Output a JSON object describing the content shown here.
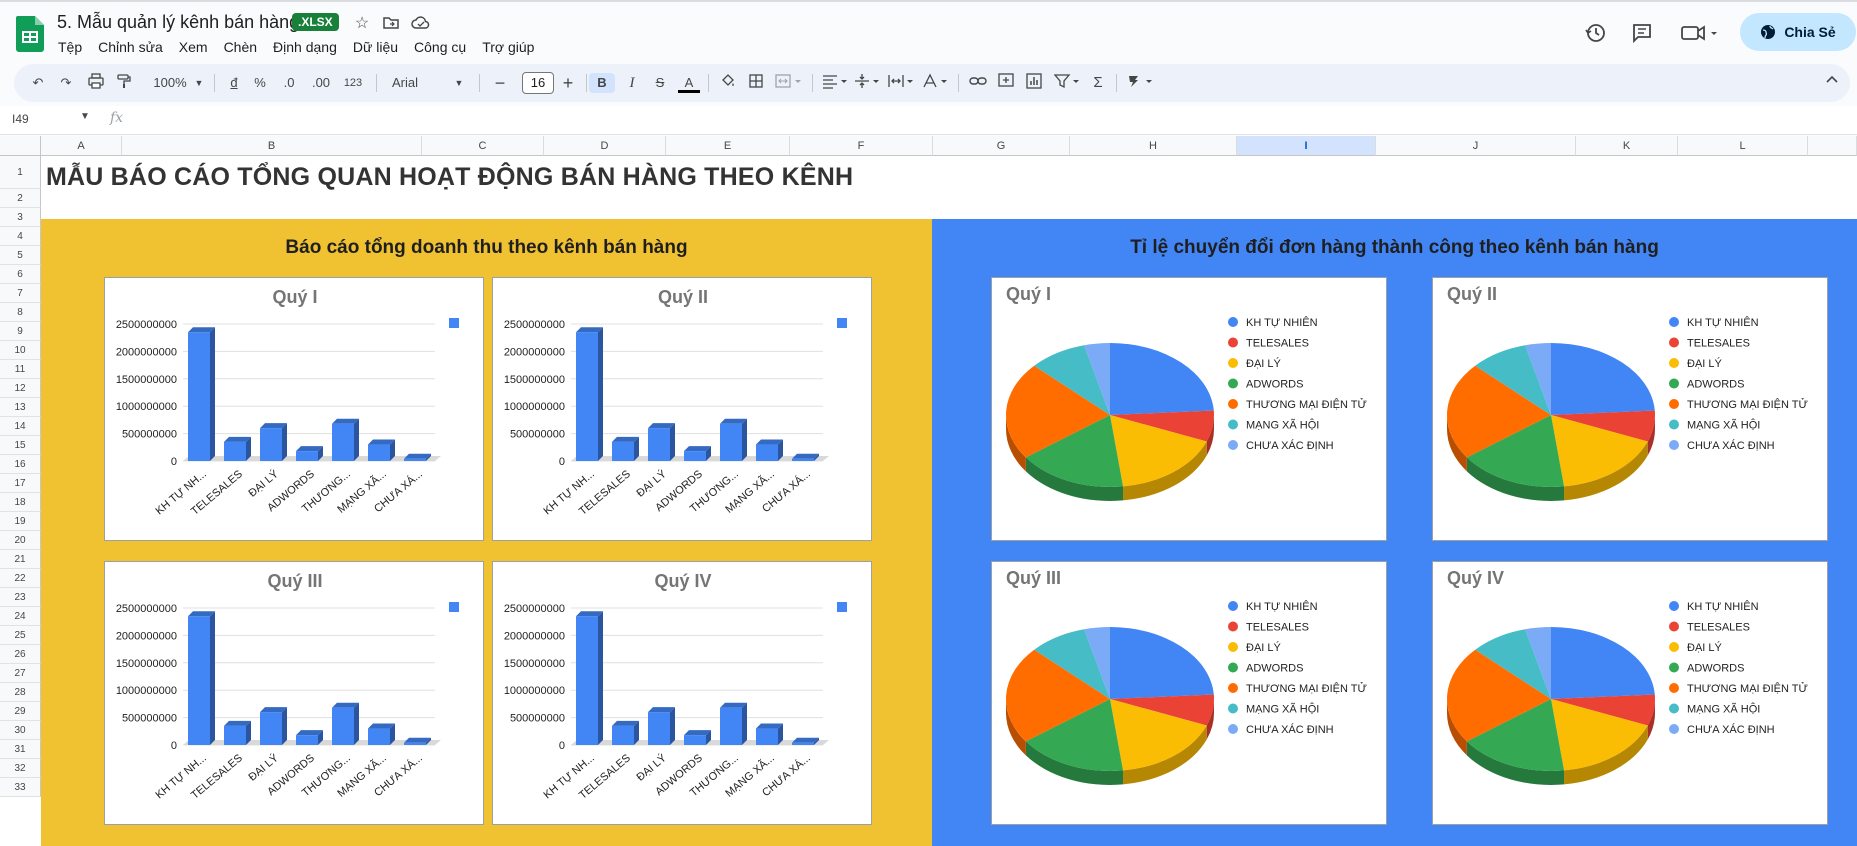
{
  "app": {
    "doc_title": "5. Mẫu quản lý kênh bán hàng",
    "file_badge": ".XLSX",
    "menu": [
      "Tệp",
      "Chỉnh sửa",
      "Xem",
      "Chèn",
      "Định dạng",
      "Dữ liệu",
      "Công cụ",
      "Trợ giúp"
    ],
    "share_label": "Chia Sẻ"
  },
  "toolbar": {
    "zoom": "100%",
    "currency": "đ",
    "percent": "%",
    "dec_decrease": ".0",
    "dec_increase": ".00",
    "number_format": "123",
    "font": "Arial",
    "font_size": "16",
    "bold": "B",
    "italic": "I",
    "strike": "S",
    "text_color": "A"
  },
  "formula_bar": {
    "cell_ref": "I49",
    "fx": "fx"
  },
  "grid": {
    "columns": [
      "A",
      "B",
      "C",
      "D",
      "E",
      "F",
      "G",
      "H",
      "I",
      "J",
      "K",
      "L"
    ],
    "selected_column": "I",
    "rows": [
      "1",
      "2",
      "3",
      "4",
      "5",
      "6",
      "7",
      "8",
      "9",
      "10",
      "11",
      "12",
      "13",
      "14",
      "15",
      "16",
      "17",
      "18",
      "19",
      "20",
      "21",
      "22",
      "23",
      "24",
      "25",
      "26",
      "27",
      "28",
      "29",
      "30",
      "31",
      "32",
      "33"
    ]
  },
  "sheet": {
    "main_title": "MẪU BÁO CÁO TỔNG QUAN HOẠT ĐỘNG BÁN HÀNG THEO KÊNH",
    "left_panel_title": "Báo cáo tổng doanh thu theo kênh bán hàng",
    "right_panel_title": "Tỉ lệ chuyển đổi đơn hàng thành công theo kênh bán hàng"
  },
  "colors": {
    "yellow_panel": "#f0c232",
    "blue_panel": "#4285f4",
    "bar": "#4285f4",
    "share_button": "#c2e7ff",
    "xlsx_badge": "#188038"
  },
  "chart_data": [
    {
      "type": "bar",
      "title": "Quý I",
      "categories": [
        "KH TỰ NH...",
        "TELESALES",
        "ĐẠI LÝ",
        "ADWORDS",
        "THƯƠNG...",
        "MẠNG XÃ...",
        "CHƯA XÁ..."
      ],
      "values": [
        2350000000,
        350000000,
        600000000,
        180000000,
        680000000,
        300000000,
        40000000
      ],
      "ylim": [
        0,
        2500000000
      ],
      "yticks": [
        "2500000000",
        "2000000000",
        "1500000000",
        "1000000000",
        "500000000",
        "0"
      ]
    },
    {
      "type": "bar",
      "title": "Quý II",
      "categories": [
        "KH TỰ NH...",
        "TELESALES",
        "ĐẠI LÝ",
        "ADWORDS",
        "THƯƠNG...",
        "MẠNG XÃ...",
        "CHƯA XÁ..."
      ],
      "values": [
        2350000000,
        350000000,
        600000000,
        180000000,
        680000000,
        300000000,
        40000000
      ],
      "ylim": [
        0,
        2500000000
      ],
      "yticks": [
        "2500000000",
        "2000000000",
        "1500000000",
        "1000000000",
        "500000000",
        "0"
      ]
    },
    {
      "type": "bar",
      "title": "Quý III",
      "categories": [
        "KH TỰ NH...",
        "TELESALES",
        "ĐẠI LÝ",
        "ADWORDS",
        "THƯƠNG...",
        "MẠNG XÃ...",
        "CHƯA XÁ..."
      ],
      "values": [
        2350000000,
        350000000,
        600000000,
        180000000,
        680000000,
        300000000,
        40000000
      ],
      "ylim": [
        0,
        2500000000
      ],
      "yticks": [
        "2500000000",
        "2000000000",
        "1500000000",
        "1000000000",
        "500000000",
        "0"
      ]
    },
    {
      "type": "bar",
      "title": "Quý IV",
      "categories": [
        "KH TỰ NH...",
        "TELESALES",
        "ĐẠI LÝ",
        "ADWORDS",
        "THƯƠNG...",
        "MẠNG XÃ...",
        "CHƯA XÁ..."
      ],
      "values": [
        2350000000,
        350000000,
        600000000,
        180000000,
        680000000,
        300000000,
        40000000
      ],
      "ylim": [
        0,
        2500000000
      ],
      "yticks": [
        "2500000000",
        "2000000000",
        "1500000000",
        "1000000000",
        "500000000",
        "0"
      ]
    },
    {
      "type": "pie",
      "title": "Quý I",
      "labels": [
        "KH TỰ NHIÊN",
        "TELESALES",
        "ĐẠI LÝ",
        "ADWORDS",
        "THƯƠNG MẠI ĐIỆN TỬ",
        "MẠNG XÃ HỘI",
        "CHƯA XÁC ĐỊNH"
      ],
      "values": [
        24,
        7,
        17,
        17,
        22,
        9,
        4
      ],
      "colors": [
        "#4285f4",
        "#ea4335",
        "#fbbc04",
        "#34a853",
        "#ff6d01",
        "#46bdc6",
        "#7baaf7"
      ]
    },
    {
      "type": "pie",
      "title": "Quý II",
      "labels": [
        "KH TỰ NHIÊN",
        "TELESALES",
        "ĐẠI LÝ",
        "ADWORDS",
        "THƯƠNG MẠI ĐIỆN TỬ",
        "MẠNG XÃ HỘI",
        "CHƯA XÁC ĐỊNH"
      ],
      "values": [
        24,
        7,
        17,
        17,
        22,
        9,
        4
      ],
      "colors": [
        "#4285f4",
        "#ea4335",
        "#fbbc04",
        "#34a853",
        "#ff6d01",
        "#46bdc6",
        "#7baaf7"
      ]
    },
    {
      "type": "pie",
      "title": "Quý III",
      "labels": [
        "KH TỰ NHIÊN",
        "TELESALES",
        "ĐẠI LÝ",
        "ADWORDS",
        "THƯƠNG MẠI ĐIỆN TỬ",
        "MẠNG XÃ HỘI",
        "CHƯA XÁC ĐỊNH"
      ],
      "values": [
        24,
        7,
        17,
        17,
        22,
        9,
        4
      ],
      "colors": [
        "#4285f4",
        "#ea4335",
        "#fbbc04",
        "#34a853",
        "#ff6d01",
        "#46bdc6",
        "#7baaf7"
      ]
    },
    {
      "type": "pie",
      "title": "Quý IV",
      "labels": [
        "KH TỰ NHIÊN",
        "TELESALES",
        "ĐẠI LÝ",
        "ADWORDS",
        "THƯƠNG MẠI ĐIỆN TỬ",
        "MẠNG XÃ HỘI",
        "CHƯA XÁC ĐỊNH"
      ],
      "values": [
        24,
        7,
        17,
        17,
        22,
        9,
        4
      ],
      "colors": [
        "#4285f4",
        "#ea4335",
        "#fbbc04",
        "#34a853",
        "#ff6d01",
        "#46bdc6",
        "#7baaf7"
      ]
    }
  ]
}
